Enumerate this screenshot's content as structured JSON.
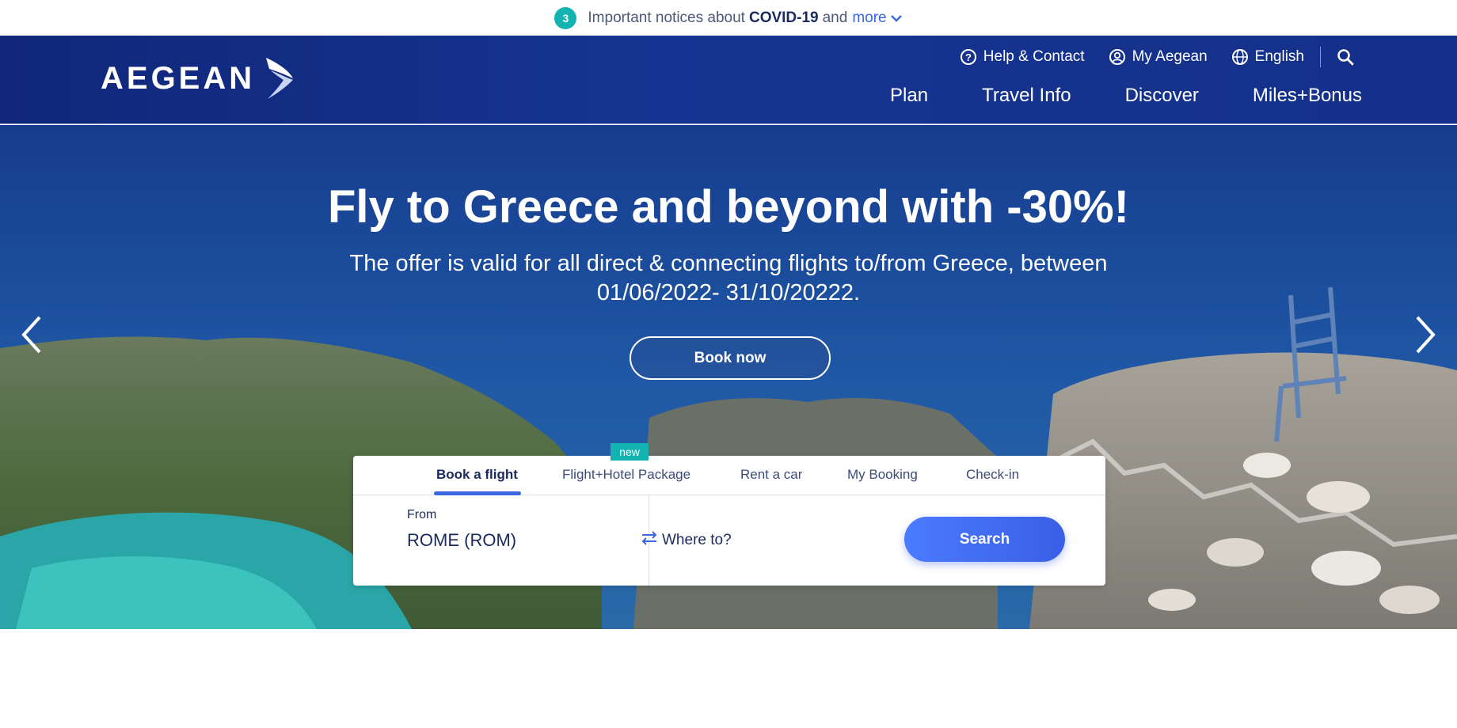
{
  "notice": {
    "count": "3",
    "prefix": "Important notices about",
    "highlight": "COVID-19",
    "conjunction": "and",
    "more_link": "more",
    "more_icon": "chevron-down-icon"
  },
  "header": {
    "logo": "AEGEAN",
    "utility": {
      "help": "Help & Contact",
      "account": "My Aegean",
      "language": "English"
    },
    "nav": [
      "Plan",
      "Travel Info",
      "Discover",
      "Miles+Bonus"
    ]
  },
  "hero": {
    "title": "Fly to Greece and beyond with -30%!",
    "subtitle": "The offer is valid for all direct & connecting flights to/from Greece, between 01/06/2022- 31/10/20222.",
    "cta": "Book now"
  },
  "booking": {
    "tabs": [
      "Book a flight",
      "Flight+Hotel Package",
      "Rent a car",
      "My Booking",
      "Check-in"
    ],
    "active_tab": "Book a flight",
    "new_badge": "new",
    "from_label": "From",
    "from_value": "ROME (ROM)",
    "to_placeholder": "Where to?",
    "search_label": "Search"
  },
  "colors": {
    "brand_navy": "#14308a",
    "accent_blue": "#3a67e0",
    "teal": "#12b3b0"
  }
}
